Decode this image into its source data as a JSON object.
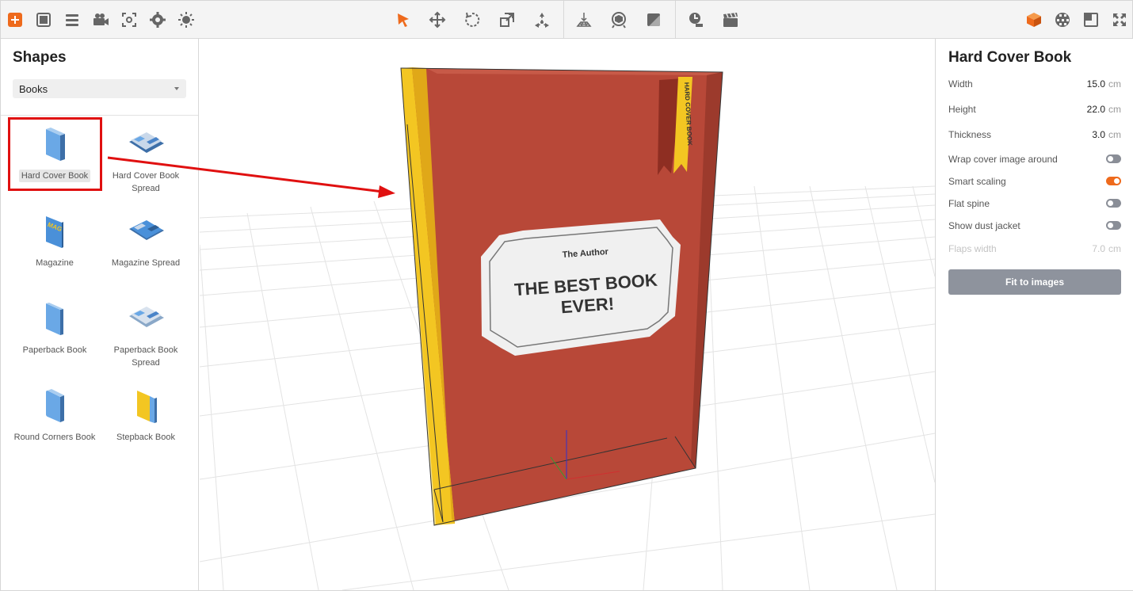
{
  "toolbar": {
    "left_icons": [
      "add-icon",
      "grid-icon",
      "list-icon",
      "camera-icon",
      "screenshot-icon",
      "settings-icon",
      "light-icon"
    ],
    "center_icons": [
      "select-icon",
      "move-icon",
      "rotate-icon",
      "scale-icon",
      "pivot-icon",
      "floor-icon",
      "view-icon",
      "material-icon",
      "timeline-icon",
      "clapper-icon"
    ],
    "right_icons": [
      "box-icon",
      "texture-icon",
      "layout-icon",
      "fullscreen-icon"
    ],
    "accent": "#ee6a1c"
  },
  "shapes_panel": {
    "title": "Shapes",
    "category": "Books",
    "items": [
      {
        "label": "Hard Cover Book",
        "selected": true
      },
      {
        "label": "Hard Cover Book Spread"
      },
      {
        "label": "Magazine"
      },
      {
        "label": "Magazine Spread"
      },
      {
        "label": "Paperback Book"
      },
      {
        "label": "Paperback Book Spread"
      },
      {
        "label": "Round Corners Book"
      },
      {
        "label": "Stepback Book"
      }
    ]
  },
  "canvas": {
    "book": {
      "author": "The Author",
      "title_line1": "THE BEST BOOK",
      "title_line2": "EVER!",
      "ribbon_text": "HARD COVER BOOK",
      "magazine_tag": "MAG",
      "cover_color": "#b84838",
      "spine_color": "#f3c622"
    }
  },
  "properties": {
    "title": "Hard Cover Book",
    "width": {
      "label": "Width",
      "value": "15.0",
      "unit": "cm"
    },
    "height": {
      "label": "Height",
      "value": "22.0",
      "unit": "cm"
    },
    "thickness": {
      "label": "Thickness",
      "value": "3.0",
      "unit": "cm"
    },
    "wrap": {
      "label": "Wrap cover image around",
      "on": false
    },
    "smart": {
      "label": "Smart scaling",
      "on": true
    },
    "flat": {
      "label": "Flat spine",
      "on": false
    },
    "dust": {
      "label": "Show dust jacket",
      "on": false
    },
    "flaps": {
      "label": "Flaps width",
      "value": "7.0",
      "unit": "cm",
      "disabled": true
    },
    "fit_button": "Fit to images"
  }
}
